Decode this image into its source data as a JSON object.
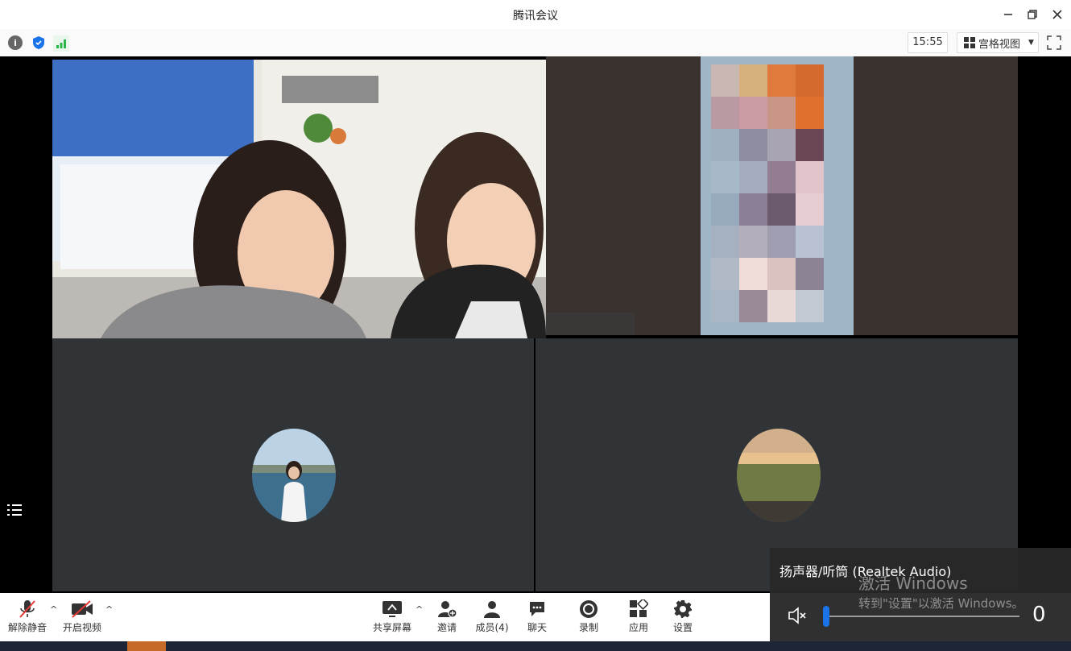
{
  "window": {
    "title": "腾讯会议",
    "minimize_icon": "minimize-icon",
    "restore_icon": "restore-icon",
    "close_icon": "close-icon"
  },
  "topbar": {
    "icons": [
      "info-icon",
      "shield-icon",
      "signal-icon"
    ],
    "clock": "15:55",
    "view_label": "宫格视图",
    "fullscreen_icon": "fullscreen-icon"
  },
  "toolbar": {
    "unmute": "解除静音",
    "start_video": "开启视频",
    "share_screen": "共享屏幕",
    "invite": "邀请",
    "members": "成员(4)",
    "chat": "聊天",
    "record": "录制",
    "apps": "应用",
    "settings": "设置"
  },
  "audio_panel": {
    "device": "扬声器/听筒 (Realtek Audio)",
    "volume": "0",
    "activation_title": "激活 Windows",
    "activation_hint": "转到\"设置\"以激活 Windows。"
  },
  "colors": {
    "accent_blue": "#1a73e8",
    "signal_green": "#2bb44a",
    "mute_red": "#e53935",
    "tile_bg": "#313437"
  }
}
